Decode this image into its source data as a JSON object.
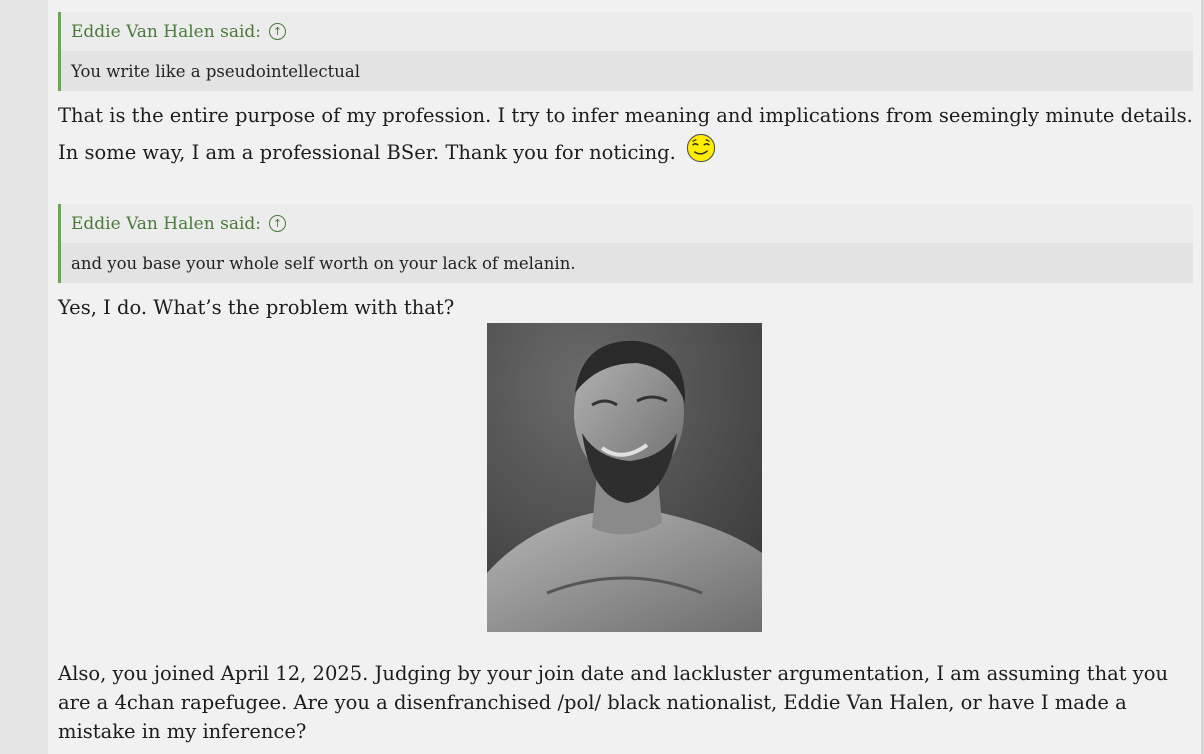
{
  "quotes": [
    {
      "author": "Eddie Van Halen said:",
      "text": "You write like a pseudointellectual"
    },
    {
      "author": "Eddie Van Halen said:",
      "text": "and you base your whole self worth on your lack of melanin."
    }
  ],
  "paragraphs": {
    "p1": "That is the entire purpose of my profession. I try to infer meaning and implications from seemingly minute details. In some way, I am a professional BSer. Thank you for noticing.",
    "p2": "Yes, I do. What’s the problem with that?",
    "p3": "Also, you joined April 12, 2025. Judging by your join date and lackluster argumentation, I am assuming that you are a 4chan rapefugee. Are you a disenfranchised /pol/ black nationalist, Eddie Van Halen, or have I made a mistake in my inference?"
  },
  "icons": {
    "quote_jump": "arrow-up-circle-icon",
    "smiley": "relieved-smiley-icon"
  },
  "colors": {
    "quote_accent": "#6aa84f",
    "quote_author": "#4a7a3a"
  }
}
